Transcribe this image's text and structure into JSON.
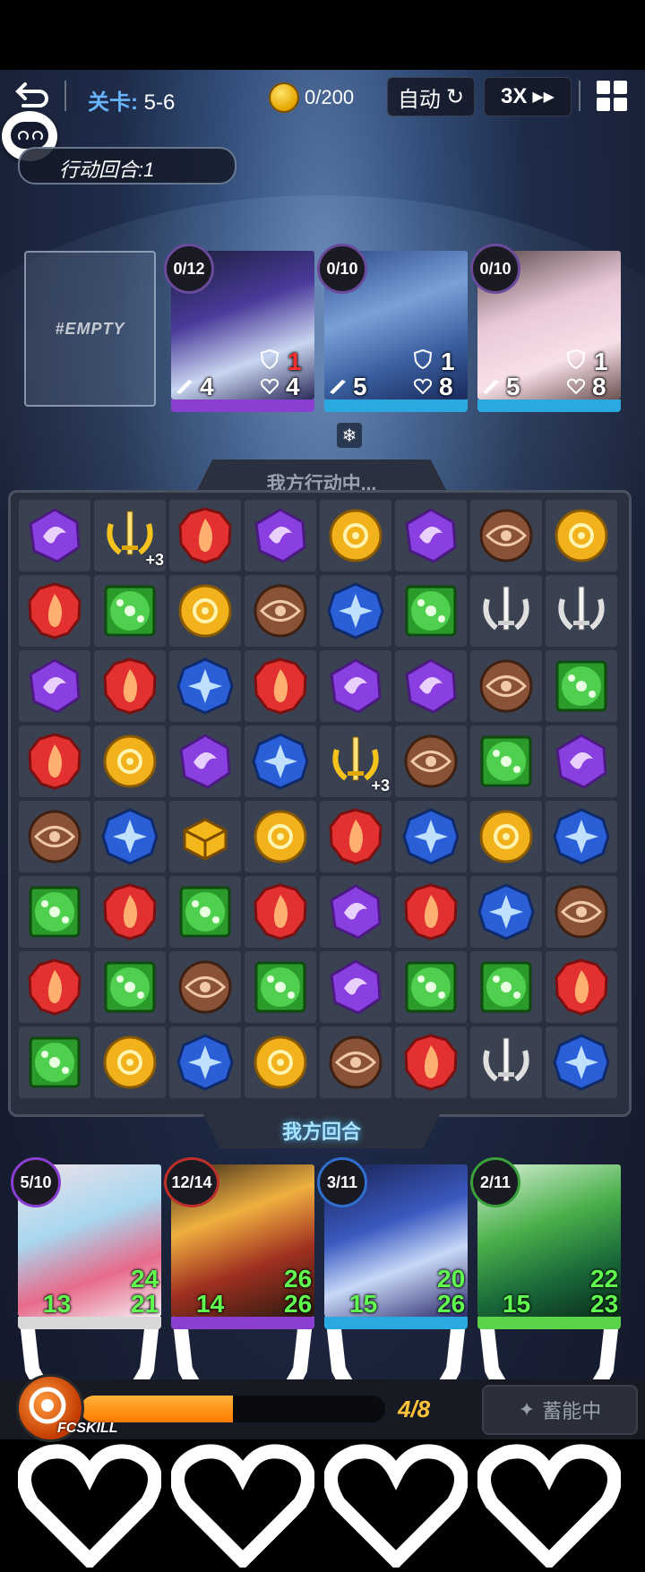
{
  "topbar": {
    "stage_label": "关卡:",
    "stage_value": "5-6",
    "coins": "0/200",
    "auto_label": "自动",
    "speed_label": "3X"
  },
  "turn": {
    "label": "行动回合:1"
  },
  "enemy": {
    "empty_label": "#EMPTY",
    "cards": [
      {
        "counter": "0/12",
        "armor": "1",
        "attack": "4",
        "hp": "4",
        "bar_color": "#8b3fd0",
        "armor_color": "#ff3030"
      },
      {
        "counter": "0/10",
        "armor": "1",
        "attack": "5",
        "hp": "8",
        "bar_color": "#2aa8e0",
        "armor_color": "#ffffff"
      },
      {
        "counter": "0/10",
        "armor": "1",
        "attack": "5",
        "hp": "8",
        "bar_color": "#2aa8e0",
        "armor_color": "#ffffff"
      }
    ]
  },
  "status_icon": "snowflake-icon",
  "board": {
    "header": "我方行动中...",
    "footer": "我方回合",
    "gem_types": {
      "P": "purple-vortex-gem",
      "R": "red-flame-gem",
      "Y": "yellow-sun-gem",
      "B": "brown-eye-gem",
      "G": "green-molecule-gem",
      "U": "blue-flower-gem",
      "W": "silver-sword-gem",
      "S": "gold-sword-gem",
      "C": "gold-chest-gem"
    },
    "rows": [
      [
        "P",
        "S",
        "R",
        "P",
        "Y",
        "P",
        "B",
        "Y"
      ],
      [
        "R",
        "G",
        "Y",
        "B",
        "U",
        "G",
        "W",
        "W"
      ],
      [
        "P",
        "R",
        "U",
        "R",
        "P",
        "P",
        "B",
        "G"
      ],
      [
        "R",
        "Y",
        "P",
        "U",
        "S",
        "B",
        "G",
        "P"
      ],
      [
        "B",
        "U",
        "C",
        "Y",
        "R",
        "U",
        "Y",
        "U"
      ],
      [
        "G",
        "R",
        "G",
        "R",
        "P",
        "R",
        "U",
        "B"
      ],
      [
        "R",
        "G",
        "B",
        "G",
        "P",
        "G",
        "G",
        "R"
      ],
      [
        "G",
        "Y",
        "U",
        "Y",
        "B",
        "R",
        "W",
        "U"
      ]
    ],
    "plus_badges": [
      {
        "row": 0,
        "col": 1,
        "text": "+3"
      },
      {
        "row": 3,
        "col": 4,
        "text": "+3"
      }
    ]
  },
  "party": [
    {
      "counter": "5/10",
      "armor": "24",
      "attack": "13",
      "hp": "21",
      "bar_color": "#d8d8d8",
      "ring": "#8b3fd0"
    },
    {
      "counter": "12/14",
      "armor": "26",
      "attack": "14",
      "hp": "26",
      "bar_color": "#8b3fd0",
      "ring": "#c0302a"
    },
    {
      "counter": "3/11",
      "armor": "20",
      "attack": "15",
      "hp": "26",
      "bar_color": "#2aa8e0",
      "ring": "#2f6fd0"
    },
    {
      "counter": "2/11",
      "armor": "22",
      "attack": "15",
      "hp": "23",
      "bar_color": "#5bd34a",
      "ring": "#3aa03a"
    }
  ],
  "footer": {
    "skill_label": "FCSKILL",
    "energy_text": "4/8",
    "energy_fraction": 0.5,
    "charge_label": "蓄能中"
  }
}
